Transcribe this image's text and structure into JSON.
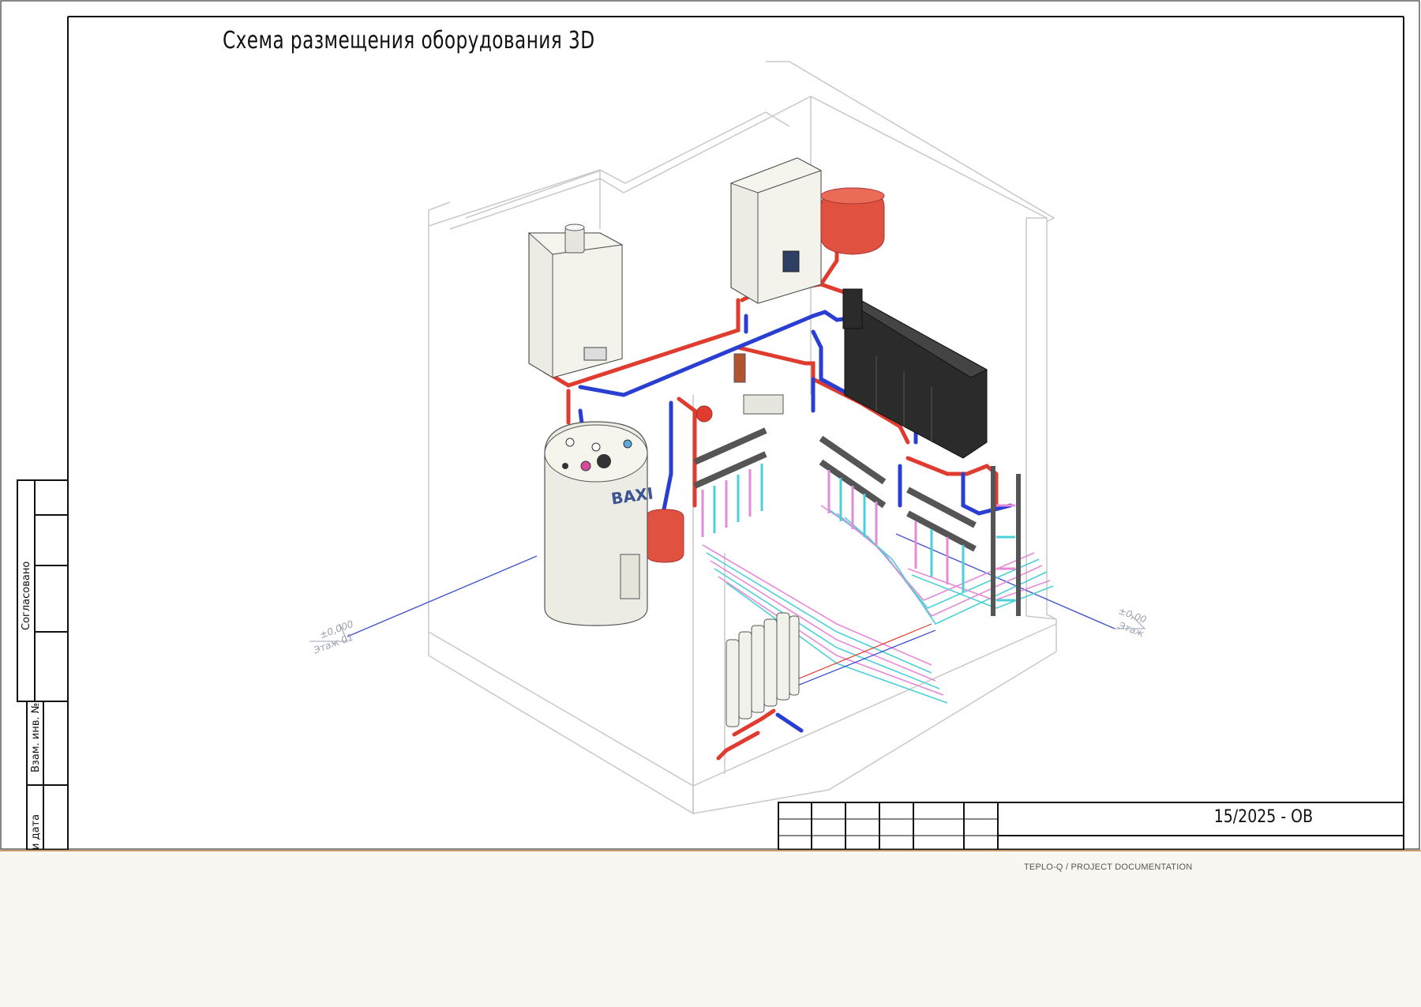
{
  "drawing": {
    "title": "Схема размещения оборудования 3D",
    "doc_code": "15/2025 - ОВ",
    "side_labels": {
      "agreed": "Согласовано",
      "replaced_inv": "Взам. инв. №",
      "signature_date": "и дата"
    },
    "levels": {
      "left_value": "±0,000",
      "left_name": "Этаж 01",
      "right_value": "±0,00",
      "right_name": "Этаж"
    },
    "brand_label": "BAXI"
  },
  "footer": {
    "text": "TEPLO-Q / PROJECT DOCUMENTATION"
  },
  "colors": {
    "supply_pipe": "#e03b2f",
    "return_pipe": "#2a3fd1",
    "floor_loop_pink": "#e58ad6",
    "floor_loop_cyan": "#4cd0d8",
    "tank_red": "#e0513f",
    "boiler_body": "#ecece4",
    "manifold_black": "#2b2b2b",
    "room_lines": "#c8c8c8",
    "footer_accent": "#c99a63"
  }
}
